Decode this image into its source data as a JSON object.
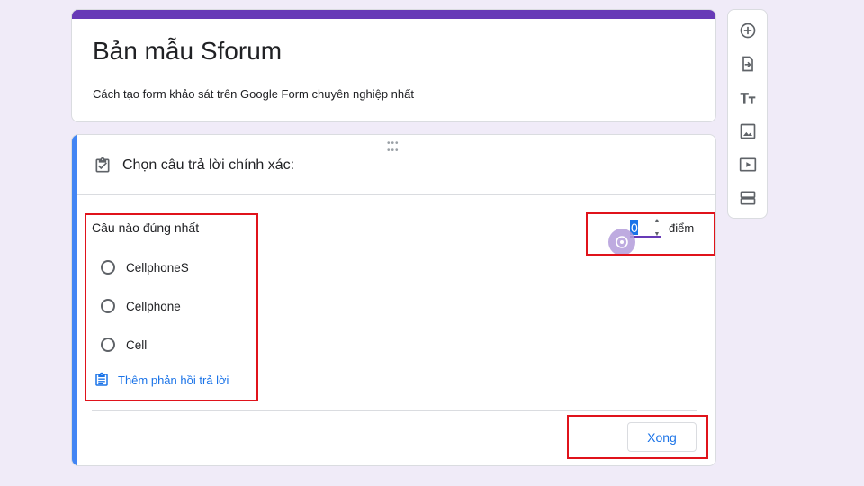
{
  "form": {
    "title": "Bản mẫu Sforum",
    "description": "Cách tạo form khảo sát trên Google Form chuyên nghiệp nhất"
  },
  "answer_key": {
    "title": "Chọn câu trả lời chính xác:",
    "question": "Câu nào đúng nhất",
    "options": [
      "CellphoneS",
      "Cellphone",
      "Cell"
    ],
    "feedback_link": "Thêm phản hồi trả lời",
    "points_value": "0",
    "points_label": "điểm",
    "done_button": "Xong"
  },
  "toolbar": {
    "icons": [
      "add-question-icon",
      "import-questions-icon",
      "add-title-icon",
      "add-image-icon",
      "add-video-icon",
      "add-section-icon"
    ]
  },
  "colors": {
    "theme": "#673ab7",
    "active_accent": "#4285f4",
    "link": "#1a73e8",
    "highlight": "#e0131b",
    "background": "#f0ebf8"
  }
}
